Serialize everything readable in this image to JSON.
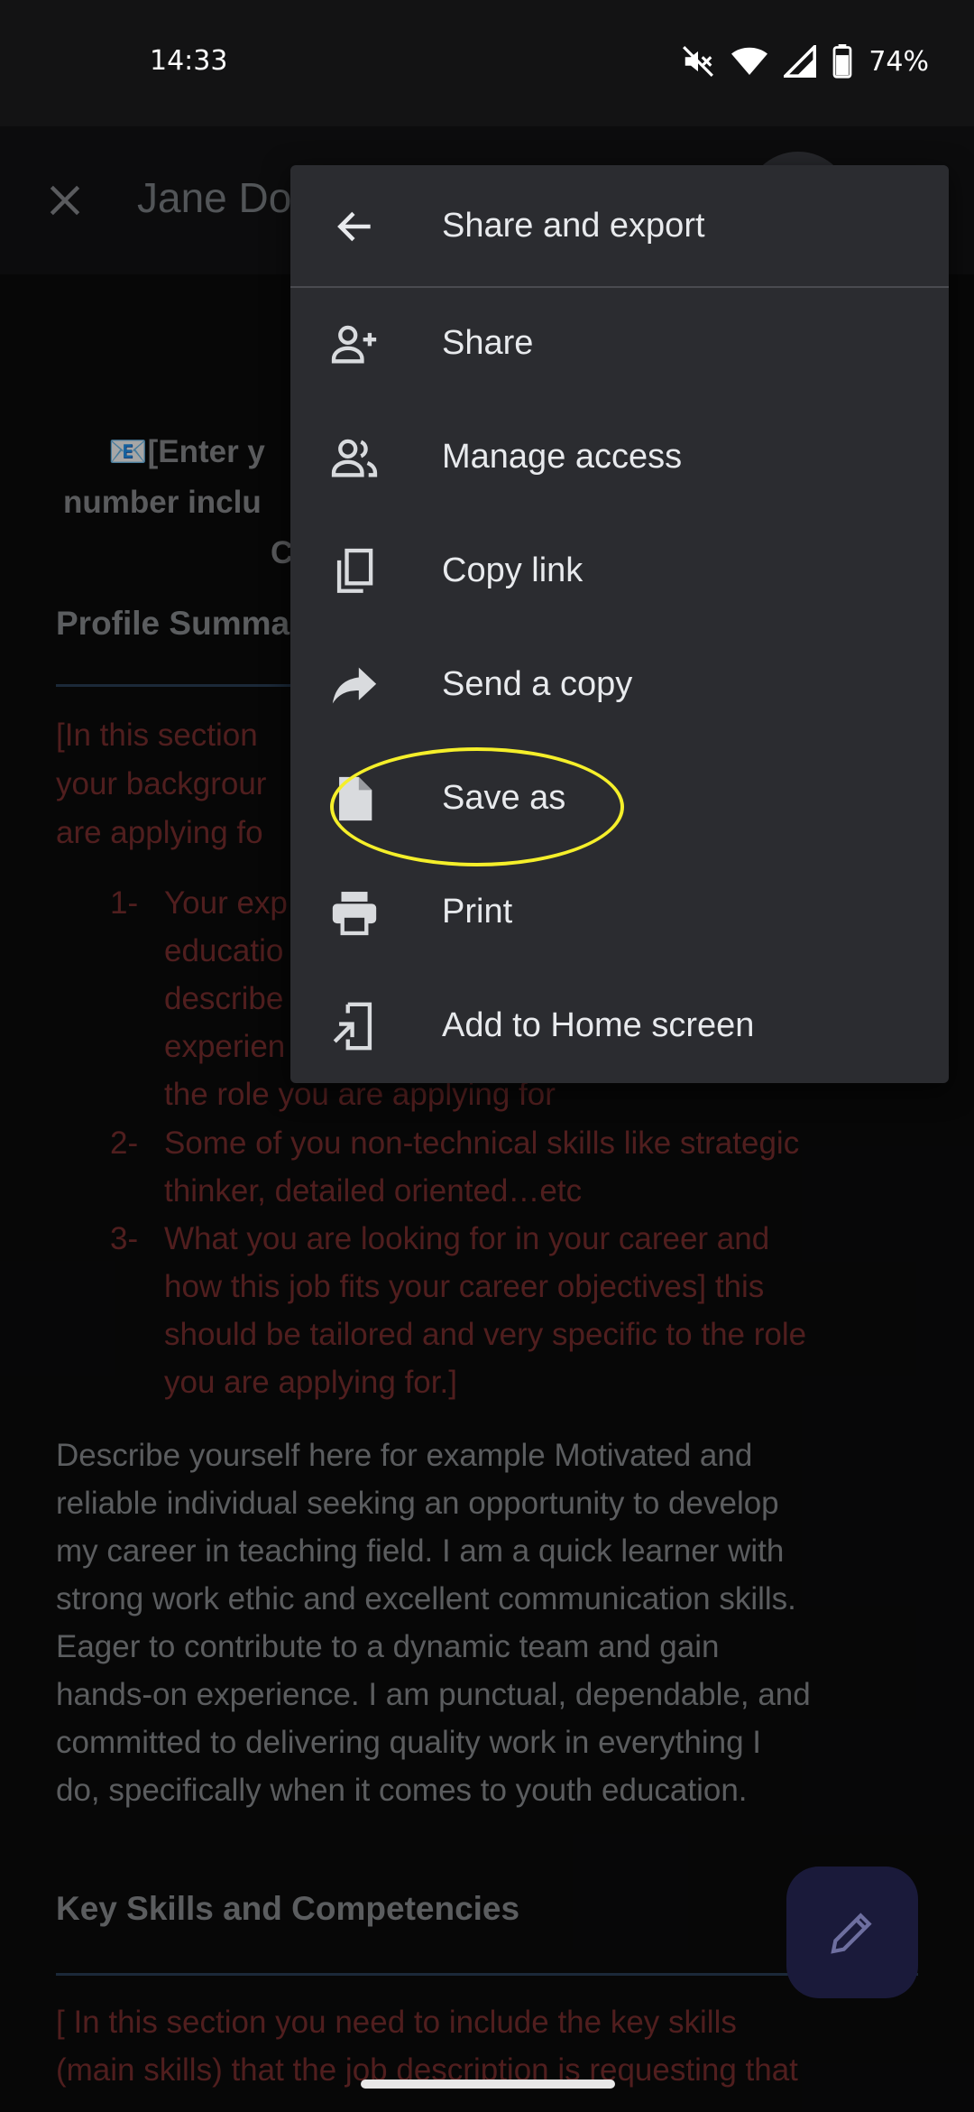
{
  "status": {
    "time": "14:33",
    "battery": "74%"
  },
  "app_bar": {
    "title": "Jane Do"
  },
  "document": {
    "contact_lines": [
      "📧[Enter y",
      "number inclu",
      "C"
    ],
    "profile_heading": "Profile Summa",
    "instr_lines": [
      "[In this section",
      "your backgrour",
      "are applying fo"
    ],
    "list": [
      {
        "num": "1-",
        "lines": [
          "Your exp",
          "educatio",
          "describe",
          "experien",
          "the role you are applying for"
        ]
      },
      {
        "num": "2-",
        "lines": [
          "Some of you non-technical skills like strategic",
          "thinker, detailed oriented…etc"
        ]
      },
      {
        "num": "3-",
        "lines": [
          "What you are looking for in your career and",
          "how this job fits your career objectives] this",
          "should be tailored and very specific to the role",
          "you are applying for.]"
        ]
      }
    ],
    "describe_lines": [
      "Describe yourself here for example Motivated and",
      "reliable individual seeking an opportunity to develop",
      "my career in teaching field. I am a quick learner with",
      "strong work ethic and excellent communication skills.",
      "Eager to contribute to a dynamic team and gain",
      "hands-on experience. I am punctual, dependable, and",
      "committed to delivering quality work in everything I",
      "do, specifically when it comes to youth education."
    ],
    "skills_heading": "Key Skills and Competencies",
    "skills_lines": [
      "[ In this section you need to include the key skills",
      "(main skills) that the job description is requesting that"
    ]
  },
  "menu": {
    "title": "Share and export",
    "items": [
      {
        "label": "Share",
        "icon": "person-add-icon"
      },
      {
        "label": "Manage access",
        "icon": "people-icon"
      },
      {
        "label": "Copy link",
        "icon": "copy-icon"
      },
      {
        "label": "Send a copy",
        "icon": "forward-arrow-icon"
      },
      {
        "label": "Save as",
        "icon": "file-icon"
      },
      {
        "label": "Print",
        "icon": "printer-icon"
      },
      {
        "label": "Add to Home screen",
        "icon": "add-to-home-icon"
      }
    ]
  },
  "colors": {
    "highlight": "#f5ef2a",
    "instruction_text": "#7c2f2f",
    "menu_bg": "#2b2c30"
  }
}
